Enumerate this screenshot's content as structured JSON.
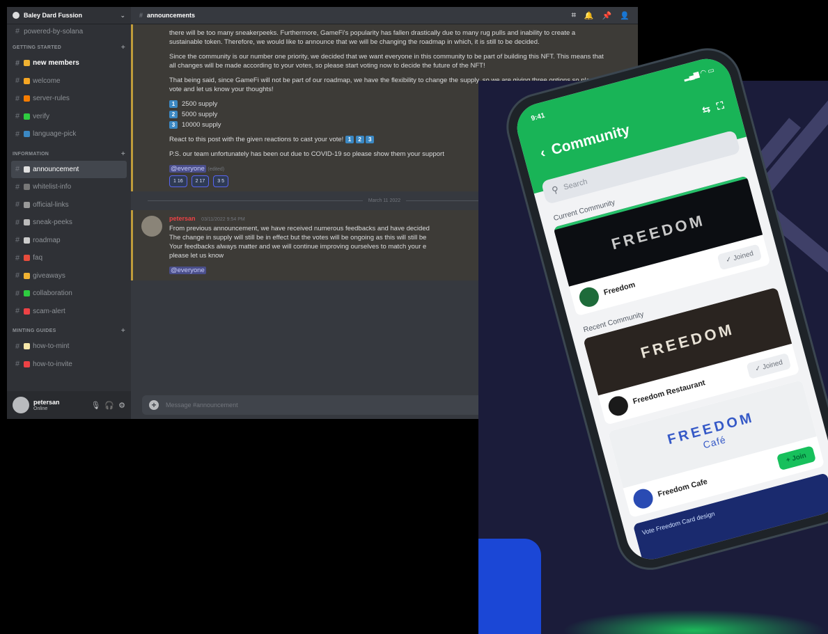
{
  "discord": {
    "server_name": "Baley Dard Fussion",
    "top_partial_channel": "powered-by-solana",
    "categories": [
      {
        "name": "Getting started",
        "channels": [
          {
            "name": "new members",
            "emoji_color": "#f0b232",
            "bold": true
          },
          {
            "name": "welcome",
            "emoji_color": "#f5a623"
          },
          {
            "name": "server-rules",
            "emoji_color": "#f57c00"
          },
          {
            "name": "verify",
            "emoji_color": "#2ecc40"
          },
          {
            "name": "language-pick",
            "emoji_color": "#3b88c3"
          }
        ]
      },
      {
        "name": "Information",
        "channels": [
          {
            "name": "announcement",
            "emoji_color": "#e0e0e0",
            "active": true
          },
          {
            "name": "whitelist-info",
            "emoji_color": "#777777"
          },
          {
            "name": "official-links",
            "emoji_color": "#999999"
          },
          {
            "name": "sneak-peeks",
            "emoji_color": "#bbbbbb"
          },
          {
            "name": "roadmap",
            "emoji_color": "#cccccc"
          },
          {
            "name": "faq",
            "emoji_color": "#e74c3c"
          },
          {
            "name": "giveaways",
            "emoji_color": "#f0b232"
          },
          {
            "name": "collaboration",
            "emoji_color": "#2ecc40"
          },
          {
            "name": "scam-alert",
            "emoji_color": "#ed4245"
          }
        ]
      },
      {
        "name": "Minting Guides",
        "channels": [
          {
            "name": "how-to-mint",
            "emoji_color": "#f5e6a8"
          },
          {
            "name": "how-to-invite",
            "emoji_color": "#ed4245"
          }
        ]
      }
    ],
    "header_channel": "announcements",
    "user": {
      "name": "petersan",
      "status": "Online"
    },
    "messages": {
      "first_lines": [
        "there will be too many sneakerpeeks. Furthermore, GameFi's popularity has fallen drastically due to many rug pulls and inability",
        "to create a sustainable token. Therefore, we would like to announce that we will be changing the roadmap in which, it is still",
        "to be decided."
      ],
      "para2": "Since the community is our number one priority, we decided that we want everyone in this community to be part of building this NFT. This means that all changes will be made according to your votes, so please start voting now to decide the future of the NFT!",
      "para3": "That being said, since GameFi will not be part of our roadmap, we have the flexibility to change the supply, so we are giving three options so please vote and let us know your thoughts!",
      "options": [
        {
          "num": "1",
          "text": "2500 supply"
        },
        {
          "num": "2",
          "text": "5000 supply"
        },
        {
          "num": "3",
          "text": "10000 supply"
        }
      ],
      "react_line": "React to this post with the given reactions to cast your vote!",
      "ps_line": "P.S. our team unfortunately has been out due to COVID-19 so please show them your support",
      "mention": "@everyone",
      "edited": "(edited)",
      "reactions": [
        "1 16",
        "2 17",
        "3 5"
      ],
      "date_divider": "March 11 2022",
      "author": "petersan",
      "timestamp": "03/11/2022 9:54 PM",
      "second_lines": [
        "From previous announcement, we have received numerous feedbacks and have decided",
        "The change in supply will still be in effect but the votes will be ongoing as this will still be",
        "Your feedbacks always matter and we will continue improving ourselves to match your e",
        "please let us know"
      ],
      "mention2": "@everyone",
      "input_placeholder": "Message #announcement"
    }
  },
  "phone": {
    "time": "9:41",
    "title": "Community",
    "search_placeholder": "Search",
    "current_label": "Current Community",
    "recent_label": "Recent Community",
    "cards": [
      {
        "banner": "FREEDOM",
        "name": "Freedom",
        "action": "✓ Joined",
        "logo_color": "#1e6b3a"
      },
      {
        "banner": "FREEDOM",
        "name": "Freedom Restaurant",
        "action": "✓ Joined",
        "logo_color": "#1a1a1a"
      },
      {
        "banner": "FREEDOM",
        "banner_sub": "Café",
        "name": "Freedom Cafe",
        "action": "+ Join",
        "logo_color": "#2a4bb3"
      }
    ],
    "last_card_text": "Vote Freedom Card design"
  }
}
